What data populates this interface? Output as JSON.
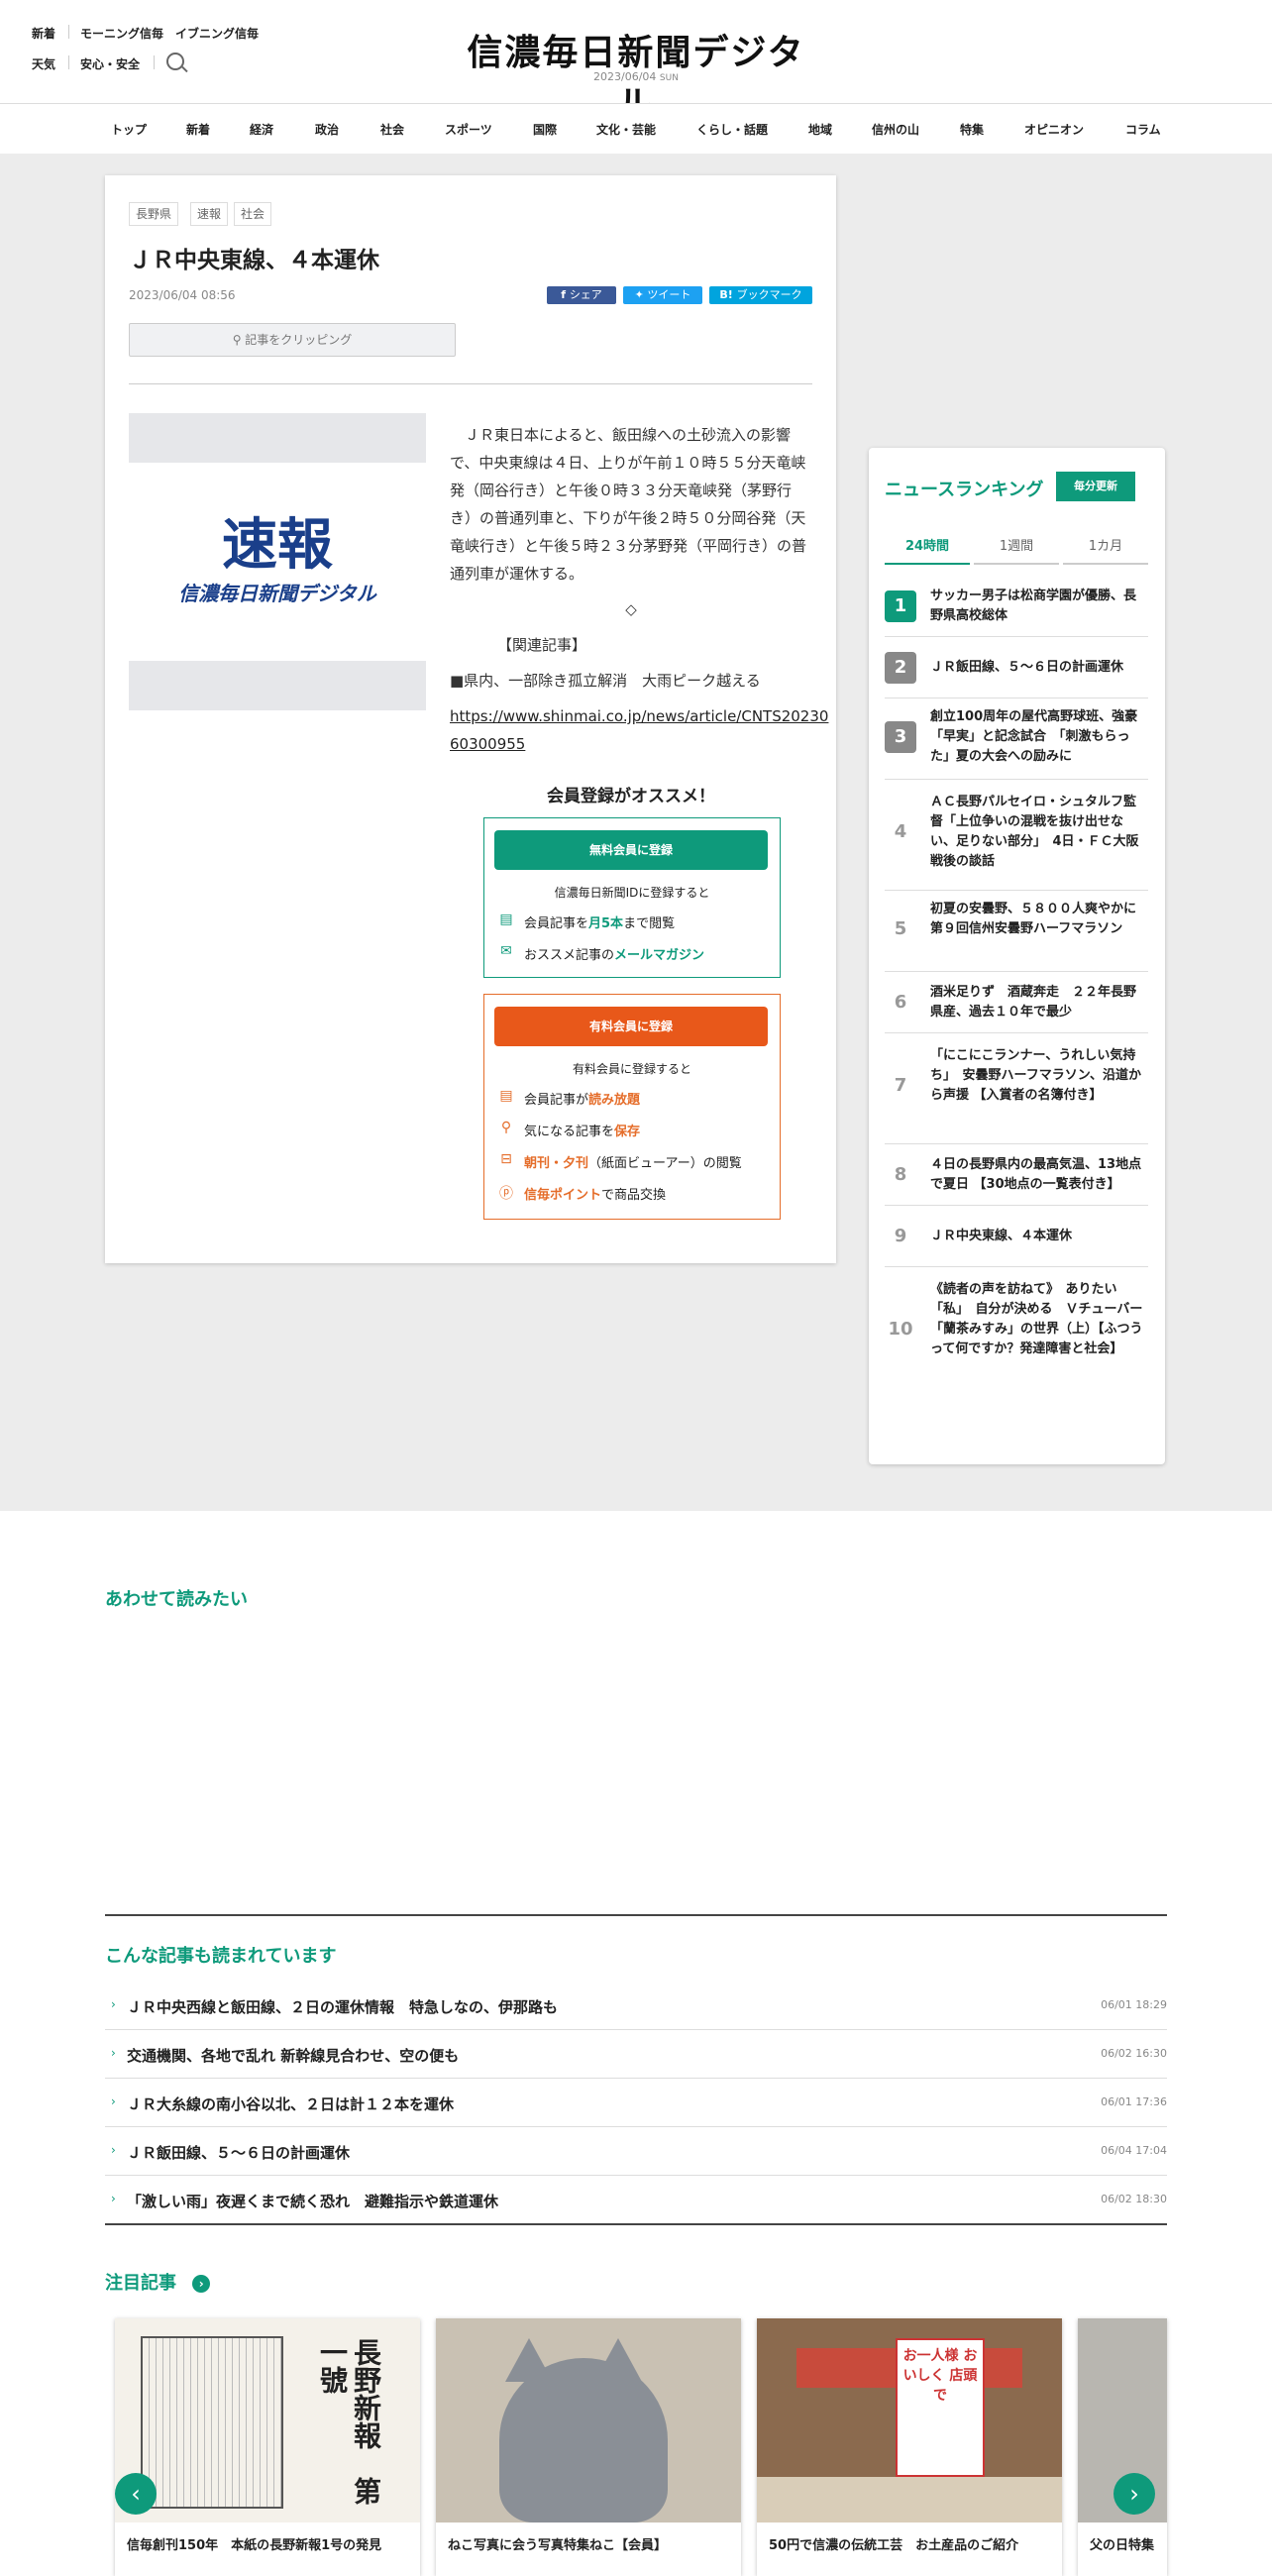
{
  "header": {
    "top_links_row1": [
      "新着",
      "モーニング信毎",
      "イブニング信毎"
    ],
    "top_links_row2": [
      "天気",
      "安心・安全"
    ],
    "logo": "信濃毎日新聞デジタル",
    "date": "2023/06/04",
    "weekday": "SUN"
  },
  "nav": [
    "トップ",
    "新着",
    "経済",
    "政治",
    "社会",
    "スポーツ",
    "国際",
    "文化・芸能",
    "くらし・話題",
    "地域",
    "信州の山",
    "特集",
    "オピニオン",
    "コラム"
  ],
  "article": {
    "tags": [
      "長野県",
      "速報",
      "社会"
    ],
    "title": "ＪＲ中央東線、４本運休",
    "published": "2023/06/04 08:56",
    "share": {
      "facebook": "シェア",
      "twitter": "ツイート",
      "hatena": "ブックマーク"
    },
    "clip_label": "記事をクリッピング",
    "image_text": "速報",
    "image_subtext": "信濃毎日新聞デジタル",
    "body": "　ＪＲ東日本によると、飯田線への土砂流入の影響で、中央東線は４日、上りが午前１０時５５分天竜峡発（岡谷行き）と午後０時３３分天竜峡発（茅野行き）の普通列車と、下りが午後２時５０分岡谷発（天竜峡行き）と午後５時２３分茅野発（平岡行き）の普通列車が運休する。",
    "diamond": "◇",
    "related_label": "【関連記事】",
    "related_item": "■県内、一部除き孤立解消　大雨ピーク越える",
    "related_url": "https://www.shinmai.co.jp/news/article/CNTS2023060300955",
    "related_url_line1": "https://www.shinmai.co.jp/news/article/CNTS20230",
    "related_url_line2": "60300955"
  },
  "membership": {
    "heading": "会員登録がオススメ！",
    "free": {
      "button": "無料会員に登録",
      "sub": "信濃毎日新聞IDに登録すると",
      "feature1_pre": "会員記事を",
      "feature1_hl": "月5本",
      "feature1_post": "まで閲覧",
      "feature2_pre": "おススメ記事の",
      "feature2_hl": "メールマガジン"
    },
    "paid": {
      "button": "有料会員に登録",
      "sub": "有料会員に登録すると",
      "f1_pre": "会員記事が",
      "f1_hl": "読み放題",
      "f2_pre": "気になる記事を",
      "f2_hl": "保存",
      "f3_hl": "朝刊・夕刊",
      "f3_post": "（紙面ビューアー）の閲覧",
      "f4_hl": "信毎ポイント",
      "f4_post": "で商品交換"
    }
  },
  "ranking": {
    "heading": "ニュースランキング",
    "update": "毎分更新",
    "tabs": [
      "24時間",
      "1週間",
      "1カ月"
    ],
    "items": [
      {
        "n": "1",
        "t": "サッカー男子は松商学園が優勝、長野県高校総体"
      },
      {
        "n": "2",
        "t": "ＪＲ飯田線、５～６日の計画運休"
      },
      {
        "n": "3",
        "t": "創立100周年の屋代高野球班、強豪「早実」と記念試合　「刺激もらった」夏の大会への励みに"
      },
      {
        "n": "4",
        "t": "ＡＣ長野パルセイロ・シュタルフ監督「上位争いの混戦を抜け出せない、足りない部分」　4日・ＦＣ大阪戦後の談話"
      },
      {
        "n": "5",
        "t": "初夏の安曇野、５８００人爽やかに　第９回信州安曇野ハーフマラソン"
      },
      {
        "n": "6",
        "t": "酒米足りず　酒蔵奔走　２２年長野県産、過去１０年で最少"
      },
      {
        "n": "7",
        "t": "「にこにこランナー、うれしい気持ち」　安曇野ハーフマラソン、沿道から声援 【入賞者の名簿付き】"
      },
      {
        "n": "8",
        "t": "４日の長野県内の最高気温、13地点で夏日 【30地点の一覧表付き】"
      },
      {
        "n": "9",
        "t": "ＪＲ中央東線、４本運休"
      },
      {
        "n": "10",
        "t": "《読者の声を訪ねて》　ありたい「私」　自分が決める　Ｖチューバー「蘭茶みすみ」の世界（上）【ふつうって何ですか？発達障害と社会】"
      }
    ]
  },
  "related": {
    "heading": "あわせて読みたい"
  },
  "popular": {
    "heading": "こんな記事も読まれています",
    "items": [
      {
        "t": "ＪＲ中央西線と飯田線、２日の運休情報　特急しなの、伊那路も",
        "d": "06/01 18:29"
      },
      {
        "t": "交通機関、各地で乱れ 新幹線見合わせ、空の便も",
        "d": "06/02 16:30"
      },
      {
        "t": "ＪＲ大糸線の南小谷以北、２日は計１２本を運休",
        "d": "06/01 17:36"
      },
      {
        "t": "ＪＲ飯田線、５～６日の計画運休",
        "d": "06/04 17:04"
      },
      {
        "t": "「激しい雨」夜遅くまで続く恐れ　避難指示や鉄道運休",
        "d": "06/02 18:30"
      }
    ]
  },
  "featured": {
    "heading": "注目記事",
    "cards": [
      {
        "img_text": "長野新報　第一號",
        "caption": "信毎創刊150年　本紙の長野新報1号の発見"
      },
      {
        "img_text": "",
        "caption": "ねこ写真に会う写真特集ねこ【会員】"
      },
      {
        "img_text": "お一人様 おいしく 店頭で",
        "caption": "50円で信濃の伝統工芸　お土産品のご紹介"
      },
      {
        "img_text": "",
        "caption": "父の日特集"
      }
    ]
  },
  "colors": {
    "brand": "#0e9a7b",
    "accent_orange": "#e56d2a",
    "facebook": "#3b5998",
    "twitter": "#1da1f2",
    "hatena": "#00a4de",
    "rank_gray": "#888888"
  }
}
